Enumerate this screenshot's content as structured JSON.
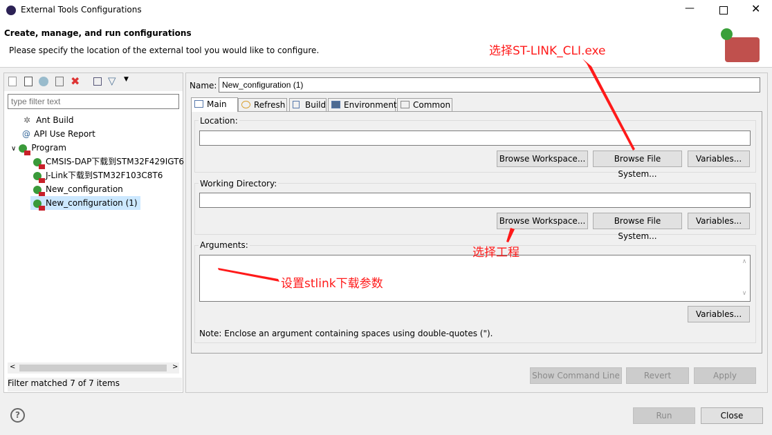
{
  "window": {
    "title": "External Tools Configurations"
  },
  "header": {
    "title": "Create, manage, and run configurations",
    "subtitle": "Please specify the location of the external tool you would like to configure."
  },
  "left": {
    "filter_placeholder": "type filter text",
    "tree": [
      {
        "label": "Ant Build",
        "icon": "ant-icon"
      },
      {
        "label": "API Use Report",
        "icon": "report-icon"
      },
      {
        "label": "Program",
        "icon": "program-icon",
        "expanded": true
      },
      {
        "label": "CMSIS-DAP下载到STM32F429IGT6",
        "icon": "program-icon"
      },
      {
        "label": "J-Link下载到STM32F103C8T6",
        "icon": "program-icon"
      },
      {
        "label": "New_configuration",
        "icon": "program-icon"
      },
      {
        "label": "New_configuration (1)",
        "icon": "program-icon",
        "selected": true
      }
    ],
    "status": "Filter matched 7 of 7 items"
  },
  "main": {
    "name_label": "Name:",
    "name_value": "New_configuration (1)",
    "tabs": [
      "Main",
      "Refresh",
      "Build",
      "Environment",
      "Common"
    ],
    "location_label": "Location:",
    "location_value": "",
    "workdir_label": "Working Directory:",
    "workdir_value": "",
    "arguments_label": "Arguments:",
    "arguments_value": "",
    "browse_workspace": "Browse Workspace...",
    "browse_fs": "Browse File System...",
    "variables": "Variables...",
    "note": "Note: Enclose an argument containing spaces using double-quotes (\").",
    "show_cmd": "Show Command Line",
    "revert": "Revert",
    "apply": "Apply"
  },
  "footer": {
    "run": "Run",
    "close": "Close"
  },
  "annotations": {
    "a1": "选择ST-LINK_CLI.exe",
    "a2": "选择工程",
    "a3": "设置stlink下载参数",
    "color": "#ff1a1a"
  }
}
